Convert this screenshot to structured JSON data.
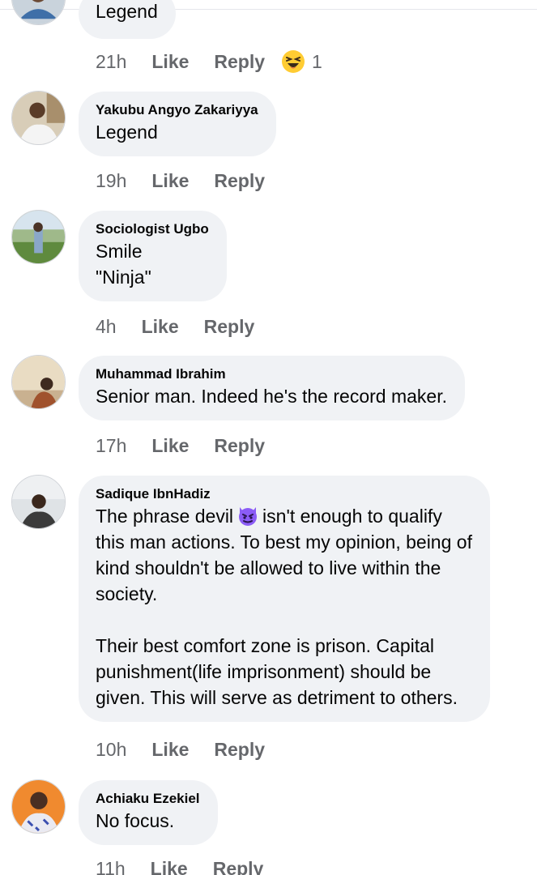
{
  "comments": [
    {
      "author": "",
      "text": "Legend",
      "time": "21h",
      "like_label": "Like",
      "reply_label": "Reply",
      "reaction_icon": "laughing-face",
      "reaction_count": "1"
    },
    {
      "author": "Yakubu Angyo Zakariyya",
      "text": "Legend",
      "time": "19h",
      "like_label": "Like",
      "reply_label": "Reply"
    },
    {
      "author": "Sociologist Ugbo",
      "text": "Smile\n\"Ninja\"",
      "time": "4h",
      "like_label": "Like",
      "reply_label": "Reply"
    },
    {
      "author": "Muhammad Ibrahim",
      "text": "Senior man. Indeed he's the record maker.",
      "time": "17h",
      "like_label": "Like",
      "reply_label": "Reply"
    },
    {
      "author": "Sadique IbnHadiz",
      "text_before_emoji": "The phrase devil",
      "emoji_icon": "devil-face",
      "text_after_emoji": "isn't enough to qualify\nthis man actions. To best my opinion, being of\nkind shouldn't be allowed to live within the\nsociety.\n\nTheir best comfort zone is prison. Capital\npunishment(life imprisonment) should be\ngiven. This will serve as detriment to others.",
      "time": "10h",
      "like_label": "Like",
      "reply_label": "Reply"
    },
    {
      "author": "Achiaku Ezekiel",
      "text": "No focus.",
      "time": "11h",
      "like_label": "Like",
      "reply_label": "Reply"
    }
  ],
  "colors": {
    "bubble": "#f0f2f5",
    "meta": "#65676b",
    "text": "#050505",
    "devil": "#8b5cf6",
    "emoji_yellow": "#ffcc33"
  }
}
